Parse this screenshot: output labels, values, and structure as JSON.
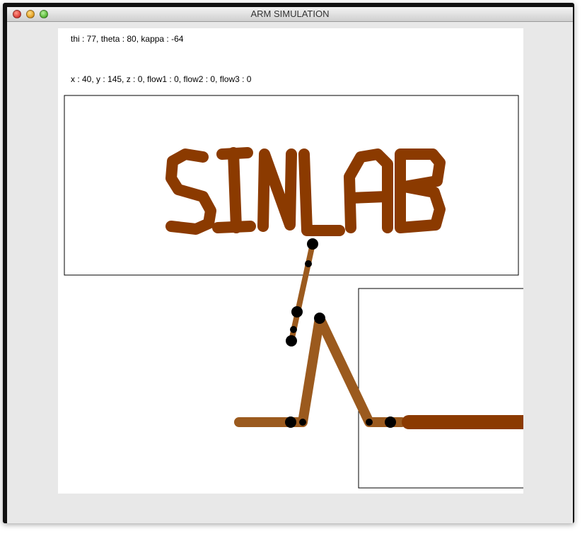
{
  "window": {
    "title": "ARM SIMULATION"
  },
  "readouts": {
    "angles": "thi : 77, theta : 80, kappa : -64",
    "position": "x : 40, y : 145, z : 0, flow1 : 0, flow2 : 0, flow3 : 0"
  },
  "drawing": {
    "text": "SINLAB",
    "ink_color": "#8B3A00"
  },
  "colors": {
    "arm": "#9B5A1E",
    "joint": "#000000",
    "box_border": "#000000"
  }
}
